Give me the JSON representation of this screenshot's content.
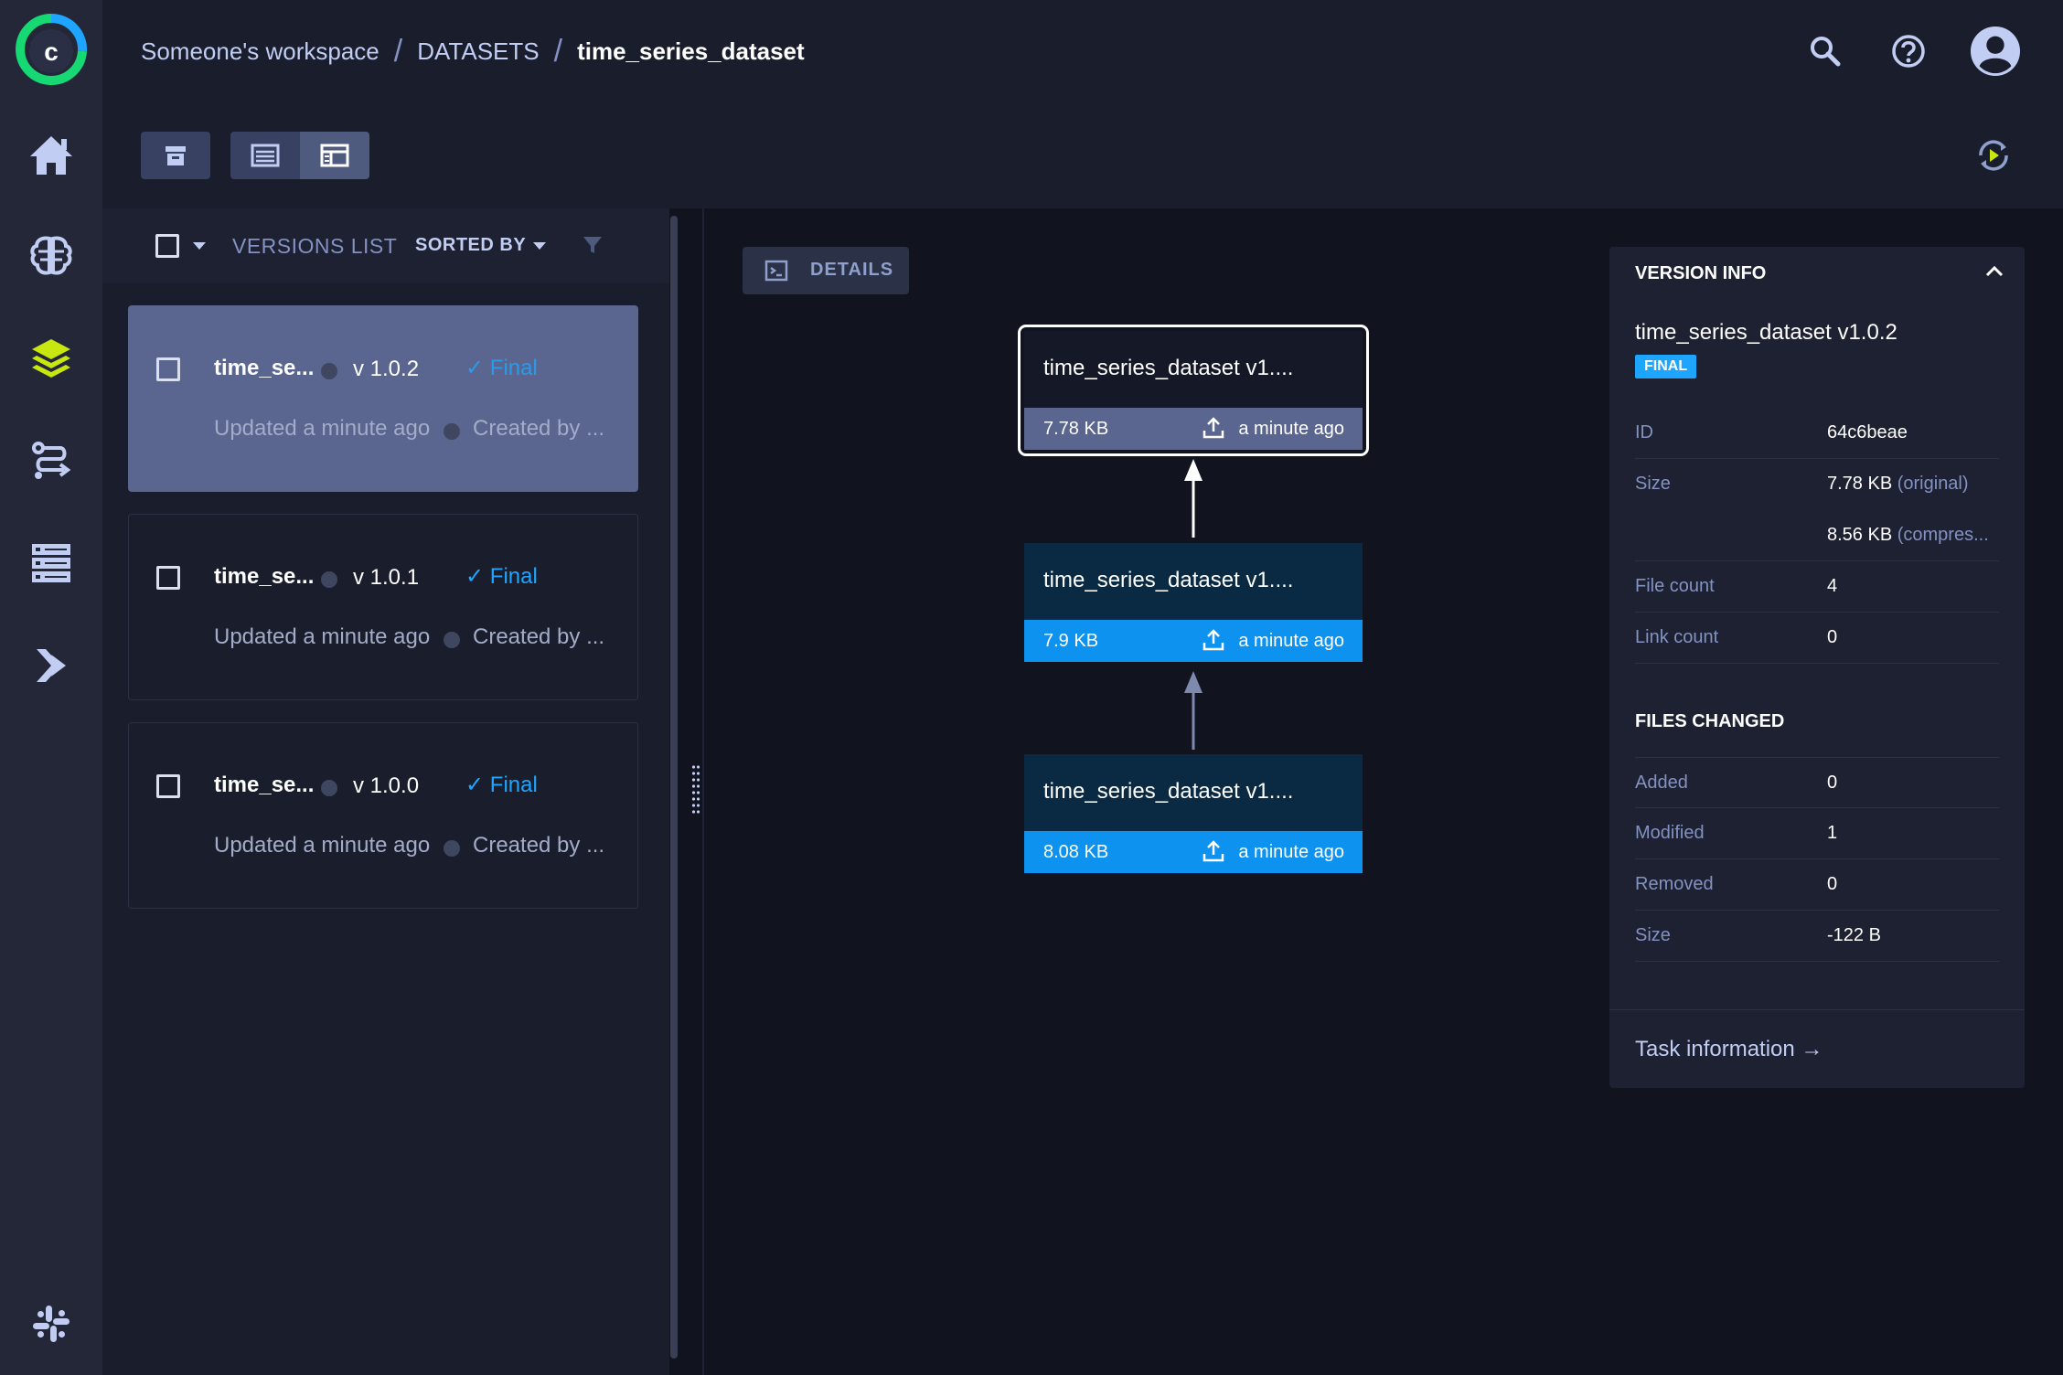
{
  "app": {
    "logo_letter": "c",
    "brand_colors": {
      "green": "#16d974",
      "blue": "#1ea5ff",
      "dark": "#2b2f45"
    }
  },
  "sidebar": {
    "items": [
      {
        "name": "home",
        "icon": "home-icon"
      },
      {
        "name": "projects",
        "icon": "brain-icon"
      },
      {
        "name": "datasets",
        "icon": "layers-icon",
        "active": true
      },
      {
        "name": "pipelines",
        "icon": "pipelines-icon"
      },
      {
        "name": "workers-and-queues",
        "icon": "server-icon"
      },
      {
        "name": "applications",
        "icon": "applications-icon"
      }
    ],
    "bottom_icon": "slack-icon"
  },
  "breadcrumb": {
    "workspace": "Someone's workspace",
    "section": "DATASETS",
    "current": "time_series_dataset",
    "separator": "/"
  },
  "header": {
    "icons": [
      "search-icon",
      "help-icon",
      "user-avatar-icon"
    ]
  },
  "toolbar": {
    "buttons": [
      "archive-icon",
      "list-view-icon",
      "details-view-icon"
    ],
    "right_icon": "auto-refresh-icon"
  },
  "versions_list": {
    "title": "VERSIONS LIST",
    "sorted_by": "SORTED BY",
    "items": [
      {
        "name": "time_se...",
        "version": "v 1.0.2",
        "status": "Final",
        "updated": "Updated a minute ago",
        "created": "Created by ..."
      },
      {
        "name": "time_se...",
        "version": "v 1.0.1",
        "status": "Final",
        "updated": "Updated a minute ago",
        "created": "Created by ..."
      },
      {
        "name": "time_se...",
        "version": "v 1.0.0",
        "status": "Final",
        "updated": "Updated a minute ago",
        "created": "Created by ..."
      }
    ]
  },
  "details": {
    "button_label": "DETAILS",
    "graph": [
      {
        "name": "time_series_dataset v1....",
        "size": "7.78 KB",
        "time": "a minute ago"
      },
      {
        "name": "time_series_dataset v1....",
        "size": "7.9 KB",
        "time": "a minute ago"
      },
      {
        "name": "time_series_dataset v1....",
        "size": "8.08 KB",
        "time": "a minute ago"
      }
    ]
  },
  "version_info": {
    "title": "VERSION INFO",
    "name": "time_series_dataset v1.0.2",
    "badge": "FINAL",
    "rows": [
      {
        "key": "ID",
        "value": "64c6beae",
        "sub": ""
      },
      {
        "key": "Size",
        "value": "7.78 KB",
        "sub": "(original)"
      },
      {
        "key": "",
        "value": "8.56 KB",
        "sub": "(compres..."
      },
      {
        "key": "File count",
        "value": "4",
        "sub": ""
      },
      {
        "key": "Link count",
        "value": "0",
        "sub": ""
      }
    ],
    "files_changed_title": "FILES CHANGED",
    "files_changed": [
      {
        "key": "Added",
        "value": "0"
      },
      {
        "key": "Modified",
        "value": "1"
      },
      {
        "key": "Removed",
        "value": "0"
      },
      {
        "key": "Size",
        "value": "-122 B"
      }
    ],
    "task_link": "Task information",
    "task_arrow": "→"
  }
}
